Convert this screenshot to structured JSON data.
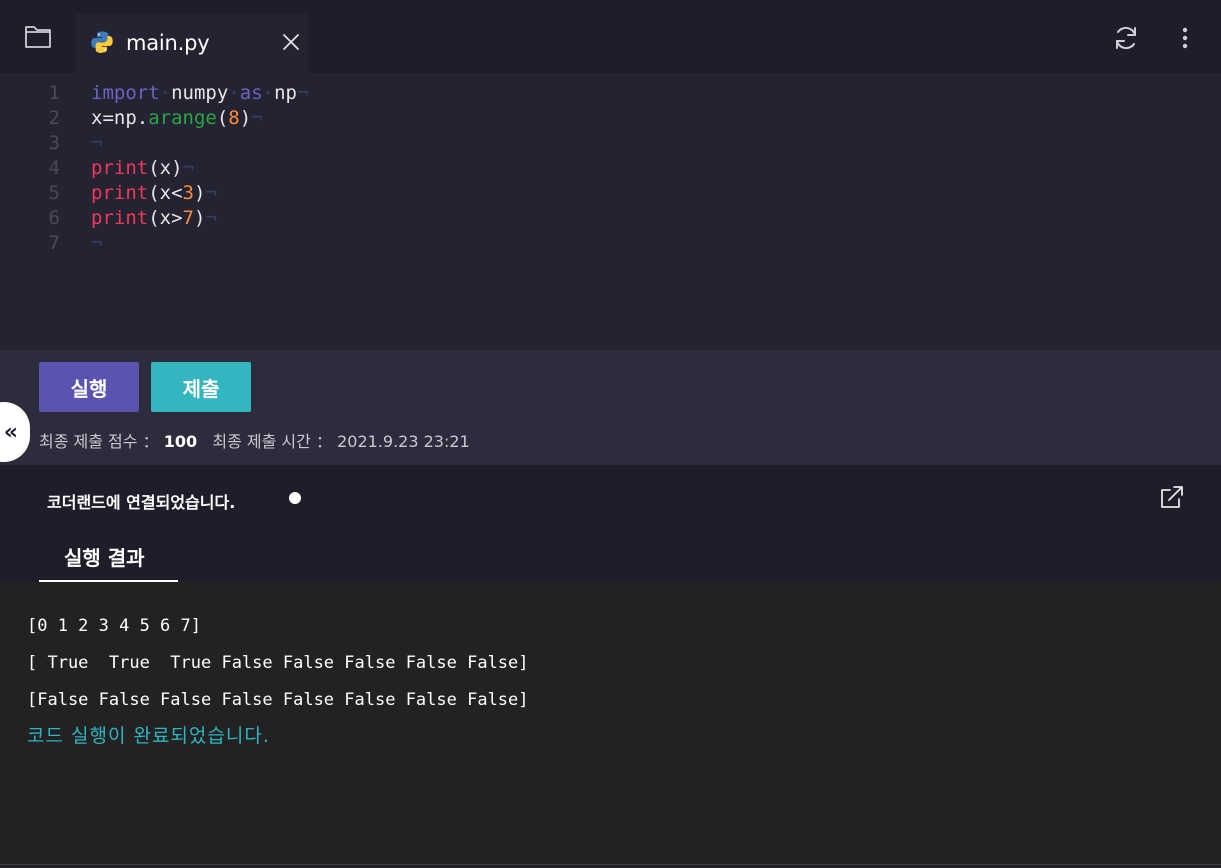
{
  "tab": {
    "filename": "main.py",
    "icon": "python-icon"
  },
  "editor": {
    "lines": [
      {
        "num": "1"
      },
      {
        "num": "2"
      },
      {
        "num": "3"
      },
      {
        "num": "4"
      },
      {
        "num": "5"
      },
      {
        "num": "6"
      },
      {
        "num": "7"
      }
    ],
    "line_end_marker": "¬",
    "ws_dot": "·",
    "tokens": {
      "import": "import",
      "numpy": "numpy",
      "as": "as",
      "np": "np",
      "x_eq_np": "x=np.",
      "arange": "arange",
      "open_paren": "(",
      "close_paren": ")",
      "eight": "8",
      "print": "print",
      "x": "x",
      "lt": "x<",
      "three": "3",
      "gt": "x>",
      "seven": "7"
    }
  },
  "actions": {
    "run_label": "실행",
    "submit_label": "제출",
    "score_label": "최종 제출 점수",
    "score_sep": "：",
    "score_value": "100",
    "time_label": "최종 제출 시간",
    "time_sep": "：",
    "time_value": "2021.9.23 23:21",
    "collapse_glyph": "«"
  },
  "console": {
    "connection_status": "코더랜드에 연결되었습니다.",
    "result_tab_label": "실행 결과",
    "output_lines": [
      "[0 1 2 3 4 5 6 7]",
      "[ True  True  True False False False False False]",
      "[False False False False False False False False]"
    ],
    "done_message": "코드 실행이 완료되었습니다."
  },
  "colors": {
    "run_button": "#5b53b0",
    "submit_button": "#35b5bf",
    "keyword": "#6b63c4",
    "print_fn": "#f0385b",
    "call_fn": "#28a745",
    "number": "#ff8a3d",
    "done_text": "#2eb5c2"
  }
}
